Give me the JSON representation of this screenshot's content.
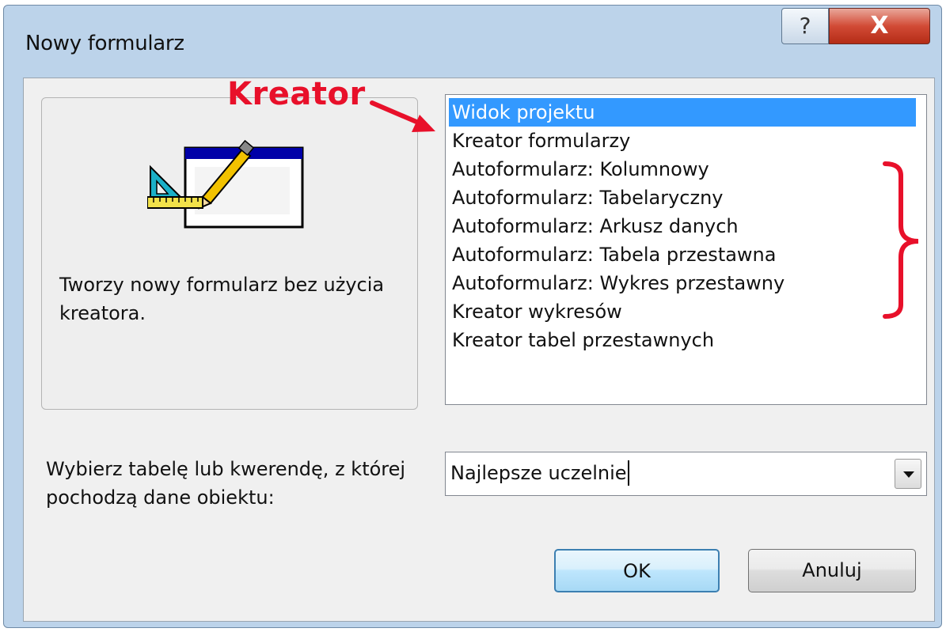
{
  "window": {
    "title": "Nowy formularz",
    "help_glyph": "?",
    "close_glyph": "X",
    "help_icon": "question-icon",
    "close_icon": "close-icon"
  },
  "preview": {
    "icon": "form-design-icon",
    "description": "Tworzy nowy formularz bez użycia kreatora."
  },
  "list": {
    "items": [
      "Widok projektu",
      "Kreator formularzy",
      "Autoformularz:  Kolumnowy",
      "Autoformularz:  Tabelaryczny",
      "Autoformularz:  Arkusz danych",
      "Autoformularz: Tabela przestawna",
      "Autoformularz: Wykres przestawny",
      "Kreator wykresów",
      "Kreator tabel przestawnych"
    ],
    "selected_index": 0
  },
  "source": {
    "label": "Wybierz tabelę lub kwerendę, z której pochodzą dane obiektu:",
    "value": "Najlepsze uczelnie"
  },
  "buttons": {
    "ok": "OK",
    "cancel": "Anuluj"
  },
  "annotation": {
    "label": "Kreator",
    "color": "#e8102a"
  },
  "colors": {
    "selection": "#3399ff",
    "dialog_frame": "#bcd3ea",
    "close_button": "#c8391f"
  }
}
